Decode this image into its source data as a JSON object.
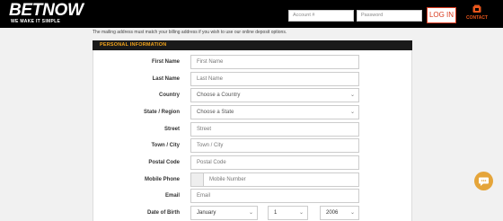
{
  "header": {
    "logo_text": "BETNOW",
    "logo_tagline": "WE MAKE IT SIMPLE",
    "account_placeholder": "Account #",
    "password_placeholder": "Password",
    "login_label": "LOG IN",
    "contact_label": "CONTACT"
  },
  "notice": "The mailing address must match your billing address if you wish to use our online deposit options.",
  "section_title": "PERSONAL INFORMATION",
  "fields": [
    {
      "label": "First Name",
      "placeholder": "First Name"
    },
    {
      "label": "Last Name",
      "placeholder": "Last Name"
    },
    {
      "label": "Country",
      "value": "Choose a Country"
    },
    {
      "label": "State / Region",
      "value": "Choose a State"
    },
    {
      "label": "Street",
      "placeholder": "Street"
    },
    {
      "label": "Town / City",
      "placeholder": "Town / City"
    },
    {
      "label": "Postal Code",
      "placeholder": "Postal Code"
    },
    {
      "label": "Mobile Phone",
      "placeholder": "Mobile Number"
    },
    {
      "label": "Email",
      "placeholder": "Email"
    },
    {
      "label": "Date of Birth",
      "month": "January",
      "day": "1",
      "year": "2006"
    }
  ],
  "colors": {
    "accent": "#e8561c",
    "section_text": "#f0a21a",
    "chat": "#e5a53a"
  },
  "icons": {
    "contact": "phone-icon",
    "chat": "chat-bubble-icon",
    "chevron": "chevron-down-icon"
  }
}
